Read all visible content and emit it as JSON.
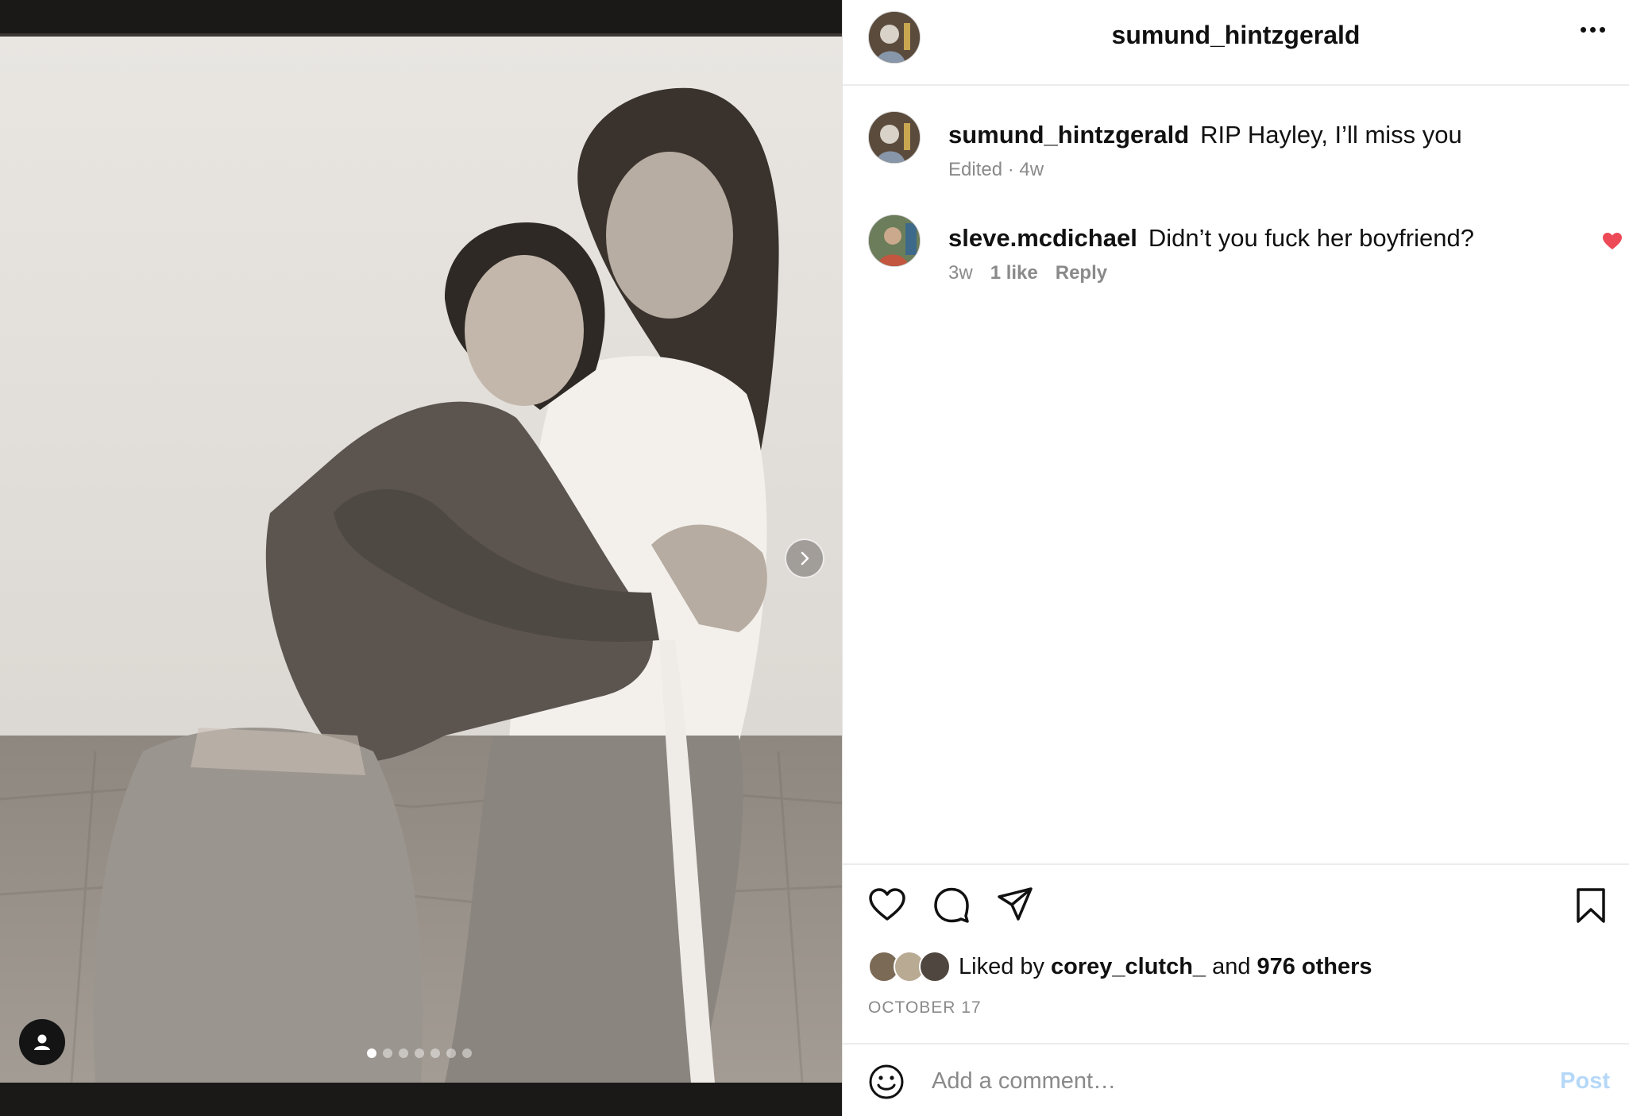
{
  "post": {
    "username": "sumund_hintzgerald",
    "caption_user": "sumund_hintzgerald",
    "caption_text": "RIP Hayley, I’ll miss you",
    "caption_meta": "Edited · 4w",
    "carousel_index": 1,
    "carousel_count": 7
  },
  "comments": [
    {
      "user": "sleve.mcdichael",
      "text": "Didn’t you fuck her boyfriend?",
      "time": "3w",
      "likes": "1 like",
      "reply": "Reply",
      "liked": true
    }
  ],
  "engagement": {
    "liked_by_prefix": "Liked by",
    "liked_by_user": "corey_clutch_",
    "liked_by_and": "and",
    "liked_by_others": "976 others",
    "date": "OCTOBER 17"
  },
  "add_comment": {
    "placeholder": "Add a comment…",
    "post_label": "Post"
  },
  "icons": {
    "more": "more-horizontal-icon",
    "like": "heart-icon",
    "comment": "comment-bubble-icon",
    "share": "send-icon",
    "save": "bookmark-icon",
    "emoji": "smiley-icon",
    "tag": "user-tag-icon",
    "next": "chevron-right-icon"
  },
  "colors": {
    "accent_heart": "#ed4956",
    "post_disabled": "#b6d8f8",
    "meta_gray": "#8a8a8a"
  }
}
